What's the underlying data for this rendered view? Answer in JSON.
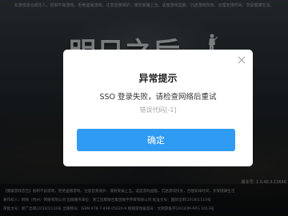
{
  "background": {
    "top_notice": "本游戏适合成年人，抵制不良游戏，拒绝盗版游戏，注意自我保护，谨防受骗上当，适度游戏益脑，沉迷游戏伤身，合理安排时间，享受健康生活。",
    "logo_text": "明日之后",
    "version": "版本号: 1.0.40.3.13646",
    "footer_lines": [
      "【健康游戏忠告】抵制不良游戏，拒绝盗版游戏，注意自我保护，谨防受骗上当，适度游戏益脑，沉迷游戏伤身，合理安排时间，享受健康生活",
      "著作权人：网易（杭州）网络有限公司    出版服务单位：浙江出版联合集团数字传媒有限公司    批准文号：国新出审[2018]1110号",
      "审批文号：新广出审[2018]1110号    出版物号：ISBN 978-7-498-05020-9    网络游戏备案号：文网游备字[2018]M-RPG 1013号"
    ]
  },
  "dialog": {
    "title": "异常提示",
    "message": "SSO 登录失败，请检查网络后重试",
    "error_code": "错误代码[-1]",
    "confirm_label": "确定",
    "close_icon": "close-icon",
    "accent_color": "#2f9bf2"
  }
}
